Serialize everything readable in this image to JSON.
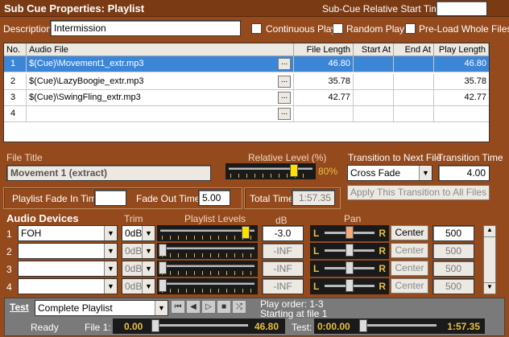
{
  "header": {
    "title": "Sub Cue Properties: Playlist",
    "relative_start_label": "Sub-Cue Relative Start Time",
    "relative_start_value": ""
  },
  "description": {
    "label": "Description",
    "value": "Intermission"
  },
  "options": [
    {
      "label": "Continuous Play",
      "checked": false
    },
    {
      "label": "Random Play",
      "checked": false
    },
    {
      "label": "Pre-Load Whole Files",
      "checked": false
    }
  ],
  "table": {
    "columns": [
      "No.",
      "Audio File",
      "File Length",
      "Start At",
      "End At",
      "Play Length"
    ],
    "rows": [
      {
        "no": "1",
        "file": "$(Cue)\\Movement1_extr.mp3",
        "length": "46.80",
        "start": "",
        "end": "",
        "play": "46.80",
        "selected": true
      },
      {
        "no": "2",
        "file": "$(Cue)\\LazyBoogie_extr.mp3",
        "length": "35.78",
        "start": "",
        "end": "",
        "play": "35.78",
        "selected": false
      },
      {
        "no": "3",
        "file": "$(Cue)\\SwingFling_extr.mp3",
        "length": "42.77",
        "start": "",
        "end": "",
        "play": "42.77",
        "selected": false
      },
      {
        "no": "4",
        "file": "",
        "length": "",
        "start": "",
        "end": "",
        "play": "",
        "selected": false
      }
    ],
    "browse_label": "..."
  },
  "file_title": {
    "label": "File Title",
    "value": "Movement 1 (extract)"
  },
  "relative_level": {
    "label": "Relative Level (%)",
    "value": "80%",
    "fraction": 0.8
  },
  "transition": {
    "label": "Transition to Next File",
    "value": "Cross Fade",
    "time_label": "Transition Time",
    "time_value": "4.00",
    "apply_label": "Apply This Transition to All Files"
  },
  "fades": {
    "fade_in_label": "Playlist Fade In Time",
    "fade_in_value": "",
    "fade_out_label": "Fade Out Time",
    "fade_out_value": "5.00"
  },
  "total_time": {
    "label": "Total Time",
    "value": "1:57.35"
  },
  "audio_devices": {
    "label": "Audio Devices",
    "trim_label": "Trim",
    "levels_label": "Playlist Levels",
    "db_label": "dB",
    "pan_label": "Pan",
    "pan_left": "L",
    "pan_right": "R",
    "center_label": "Center",
    "rows": [
      {
        "no": "1",
        "device": "FOH",
        "trim": "0dB",
        "db": "-3.0",
        "pan": "500",
        "level_fraction": 0.93,
        "active": true
      },
      {
        "no": "2",
        "device": "",
        "trim": "0dB",
        "db": "-INF",
        "pan": "500",
        "level_fraction": 0,
        "active": false
      },
      {
        "no": "3",
        "device": "",
        "trim": "0dB",
        "db": "-INF",
        "pan": "500",
        "level_fraction": 0,
        "active": false
      },
      {
        "no": "4",
        "device": "",
        "trim": "0dB",
        "db": "-INF",
        "pan": "500",
        "level_fraction": 0,
        "active": false
      }
    ]
  },
  "test": {
    "label": "Test",
    "mode": "Complete Playlist",
    "play_order": "Play order: 1-3",
    "starting": "Starting at file 1",
    "status": "Ready",
    "file_label": "File 1:",
    "file_start": "0.00",
    "file_end": "46.80",
    "test_label": "Test:",
    "test_start": "0:00.00",
    "test_end": "1:57.35"
  }
}
